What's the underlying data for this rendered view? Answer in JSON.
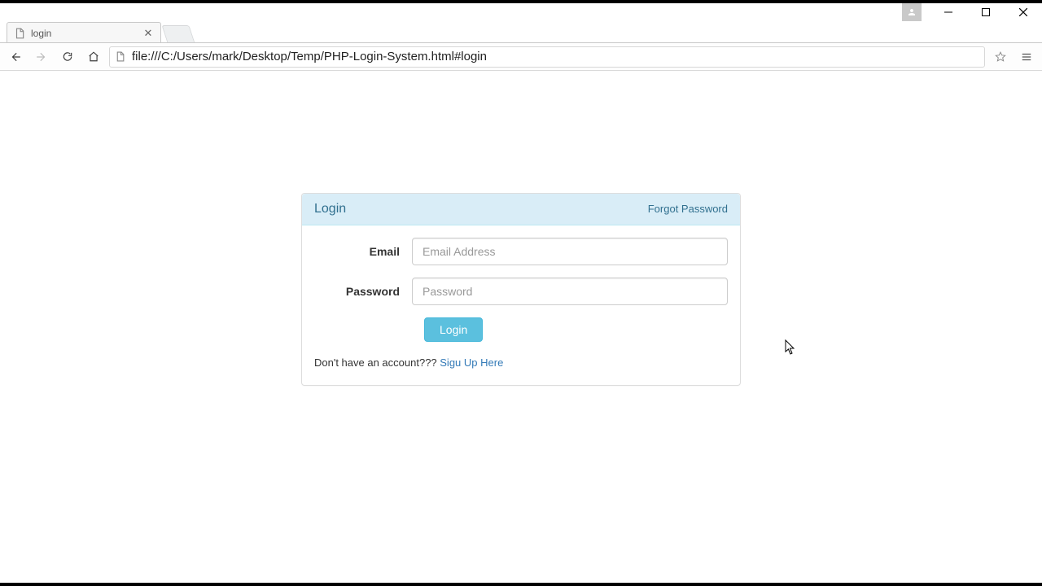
{
  "window": {
    "tab_title": "login",
    "address": "file:///C:/Users/mark/Desktop/Temp/PHP-Login-System.html#login"
  },
  "panel": {
    "title": "Login",
    "forgot_link": "Forgot Password",
    "email_label": "Email",
    "email_placeholder": "Email Address",
    "password_label": "Password",
    "password_placeholder": "Password",
    "submit_label": "Login",
    "footer_text": "Don't have an account??? ",
    "signup_link": "Sigu Up Here"
  }
}
